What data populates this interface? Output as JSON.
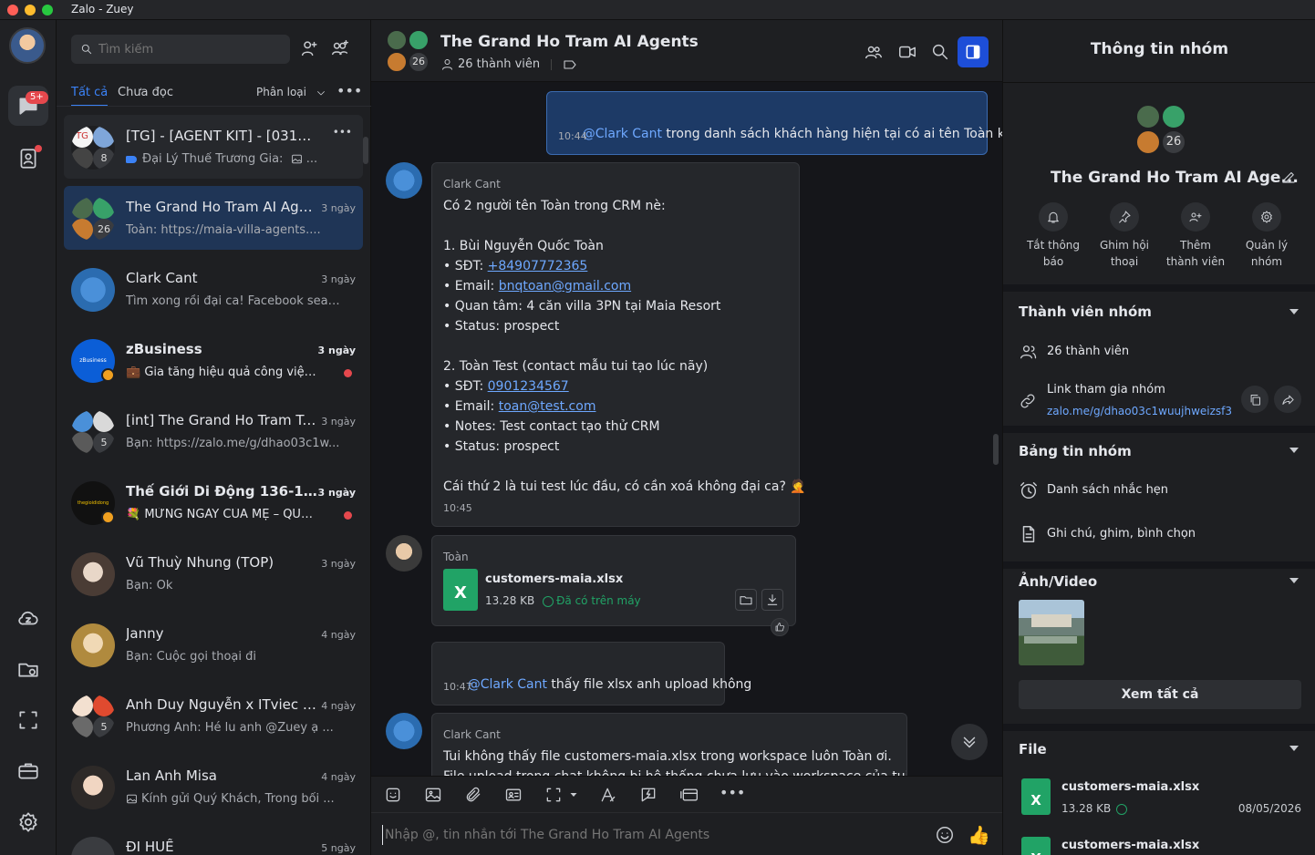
{
  "window": {
    "title": "Zalo - Zuey"
  },
  "rail": {
    "chat_badge": "5+"
  },
  "search": {
    "placeholder": "Tìm kiếm"
  },
  "tabs": {
    "all": "Tất cả",
    "unread": "Chưa đọc",
    "classify": "Phân loại"
  },
  "conversations": [
    {
      "name": "[TG] - [AGENT KIT] - [03193...",
      "preview": "Đại Lý Thuế Trương Gia:",
      "time": "",
      "members": "8"
    },
    {
      "name": "The Grand Ho Tram AI Age...",
      "preview": "Toàn: https://maia-villa-agents....",
      "time": "3 ngày",
      "members": "26"
    },
    {
      "name": "Clark Cant",
      "preview": "Tìm xong rồi đại ca! Facebook search ...",
      "time": "3 ngày"
    },
    {
      "name": "zBusiness",
      "preview": "Gia tăng hiệu quả công việc ...",
      "time": "3 ngày",
      "avatar_text": "zBusiness"
    },
    {
      "name": "[int] The Grand Ho Tram Tra...",
      "preview": "Bạn: https://zalo.me/g/dhao03c1w...",
      "time": "3 ngày",
      "members": "5"
    },
    {
      "name": "Thế Giới Di Động 136-138-...",
      "preview": "MỪNG NGÀY CỦA MẸ – QUÀ ...",
      "time": "3 ngày",
      "avatar_text": "thegioididong"
    },
    {
      "name": "Vũ Thuỳ Nhung (TOP)",
      "preview": "Bạn: Ok",
      "time": "3 ngày"
    },
    {
      "name": "Janny",
      "preview": "Bạn: Cuộc gọi thoại đi",
      "time": "4 ngày"
    },
    {
      "name": "Anh Duy Nguyễn x ITviec - ...",
      "preview": "Phương Anh: Hé lu anh @Zuey ạ ...",
      "time": "4 ngày",
      "members": "5"
    },
    {
      "name": "Lan Anh Misa",
      "preview": "Kính gửi Quý Khách, Trong bối ...",
      "time": "4 ngày"
    },
    {
      "name": "ĐI HUẾ",
      "preview": "",
      "time": "5 ngày"
    }
  ],
  "chat": {
    "title": "The Grand Ho Tram AI Agents",
    "members": "26 thành viên",
    "member_count": "26",
    "messages": [
      {
        "mention": "@Clark Cant",
        "text": " trong danh sách khách hàng hiện tại có ai tên Toàn ko?",
        "time": "10:44"
      },
      {
        "sender": "Clark Cant",
        "lines": [
          "Có 2 người tên Toàn trong CRM nè:",
          "",
          "1. Bùi Nguyễn Quốc Toàn",
          "• SĐT: ",
          "• Email: ",
          "• Quan tâm: 4 căn villa 3PN tại Maia Resort",
          "• Status: prospect",
          "",
          "2. Toàn Test (contact mẫu tui tạo lúc nãy)",
          "• SĐT: ",
          "• Email: ",
          "• Notes: Test contact tạo thử CRM",
          "• Status: prospect",
          "",
          "Cái thứ 2 là tui test lúc đầu, có cần xoá không đại ca? 🤦"
        ],
        "phone1": "+84907772365",
        "email1": "bnqtoan@gmail.com",
        "phone2": "0901234567",
        "email2": "toan@test.com",
        "time": "10:45"
      },
      {
        "sender": "Toàn",
        "file_name": "customers-maia.xlsx",
        "file_size": "13.28 KB",
        "file_status": "Đã có trên máy",
        "file_ext": "X"
      },
      {
        "mention": "@Clark Cant",
        "text": " thấy file xlsx anh upload không",
        "time": "10:47"
      },
      {
        "sender": "Clark Cant",
        "text": "Tui không thấy file customers-maia.xlsx trong workspace luôn Toàn ơi.",
        "text2": "File upload trong chat không bị hệ thống chưa lưu vào workspace của tui..."
      }
    ],
    "composer_placeholder": "Nhập @, tin nhắn tới The Grand Ho Tram AI Agents"
  },
  "info": {
    "header": "Thông tin nhóm",
    "group_name": "The Grand Ho Tram AI Age...",
    "member_count": "26",
    "actions": [
      {
        "line1": "Tắt thông",
        "line2": "báo"
      },
      {
        "line1": "Ghim hội",
        "line2": "thoại"
      },
      {
        "line1": "Thêm",
        "line2": "thành viên"
      },
      {
        "line1": "Quản lý",
        "line2": "nhóm"
      }
    ],
    "members_section": "Thành viên nhóm",
    "members_count_text": "26 thành viên",
    "join_link_label": "Link tham gia nhóm",
    "join_link": "zalo.me/g/dhao03c1wuujhweizsf3",
    "board_section": "Bảng tin nhóm",
    "reminders": "Danh sách nhắc hẹn",
    "notes": "Ghi chú, ghim, bình chọn",
    "media_section": "Ảnh/Video",
    "view_all": "Xem tất cả",
    "file_section": "File",
    "files": [
      {
        "name": "customers-maia.xlsx",
        "size": "13.28 KB",
        "date": "08/05/2026",
        "ext": "X"
      },
      {
        "name": "customers-maia.xlsx",
        "ext": "X"
      }
    ]
  },
  "colors": {
    "accent": "#3b82f6",
    "excel": "#21a366",
    "badge": "#e5484d"
  }
}
